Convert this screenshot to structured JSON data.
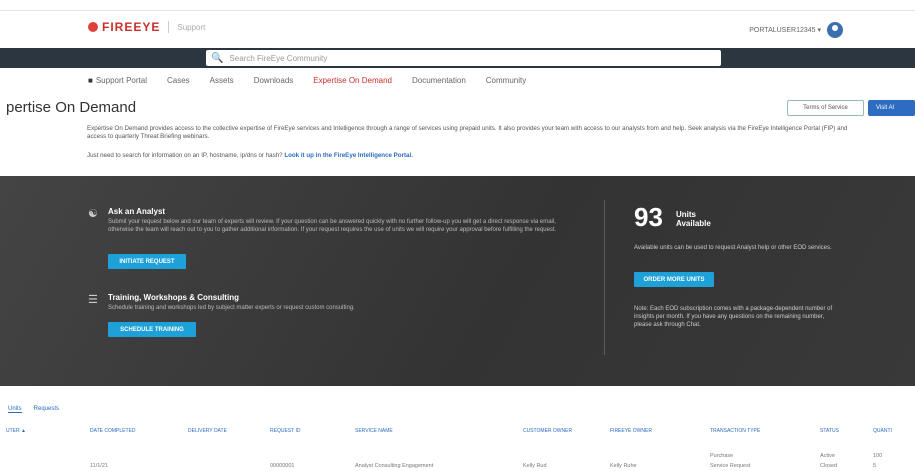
{
  "header": {
    "logo_text": "FIREEYE",
    "logo_sub": "Support",
    "username": "PORTALUSER12345 ▾",
    "accent_color": "#c9302c"
  },
  "search": {
    "placeholder": "Search FireEye Community"
  },
  "nav": [
    {
      "label": "Support Portal",
      "icon": "home-icon"
    },
    {
      "label": "Cases"
    },
    {
      "label": "Assets"
    },
    {
      "label": "Downloads"
    },
    {
      "label": "Expertise On Demand",
      "active": true
    },
    {
      "label": "Documentation"
    },
    {
      "label": "Community"
    }
  ],
  "page": {
    "title": "pertise On Demand",
    "btn_outline": "Terms of Service",
    "btn_primary": "Visit Al"
  },
  "intro": {
    "paragraph": "Expertise On Demand provides access to the collective expertise of FireEye services and Intelligence through a range of services using prepaid units. It also provides your team with access to our analysts from and help. Seek analysis via the FireEye Intelligence Portal (FIP) and access to quarterly Threat Briefing webinars.",
    "line2_prefix": "Just need to search for information on an IP, hostname, ip/dns or hash?",
    "line2_link": "Look it up in the FireEye Intelligence Portal."
  },
  "hero": {
    "item1_title": "Ask an Analyst",
    "item1_desc": "Submit your request below and our team of experts will review. If your question can be answered quickly with no further follow-up you will get a direct response via email, otherwise the team will reach out to you to gather additional information. If your request requires the use of units we will require your approval before fulfilling the request.",
    "item1_button": "INITIATE REQUEST",
    "item2_title": "Training, Workshops & Consulting",
    "item2_desc": "Schedule training and workshops led by subject matter experts or request custom consulting.",
    "item2_button": "SCHEDULE TRAINING",
    "units_number": "93",
    "units_label1": "Units",
    "units_label2": "Available",
    "units_desc": "Available units can be used to request Analyst help or other EOD services.",
    "units_button": "ORDER MORE UNITS",
    "note": "Note: Each EOD subscription comes with a package-dependent number of insights per month. If you have any questions on the remaining number, please ask through Chat."
  },
  "tabs": [
    "Units",
    "Requests"
  ],
  "table": {
    "headers": [
      "UTER ▲",
      "DATE COMPLETED",
      "DELIVERY DATE",
      "REQUEST ID",
      "SERVICE NAME",
      "CUSTOMER OWNER",
      "FIREEYE OWNER",
      "TRANSACTION TYPE",
      "STATUS",
      "QUANTI"
    ],
    "rows": [
      [
        "",
        "",
        "",
        "",
        "",
        "",
        "",
        "Purchase",
        "Active",
        "100"
      ],
      [
        "",
        "11/1/21",
        "",
        "00000001",
        "Analyst Consulting Engagement",
        "Kelly Rud",
        "Kelly Ruhe",
        "Service Request",
        "Closed",
        "5"
      ]
    ]
  }
}
